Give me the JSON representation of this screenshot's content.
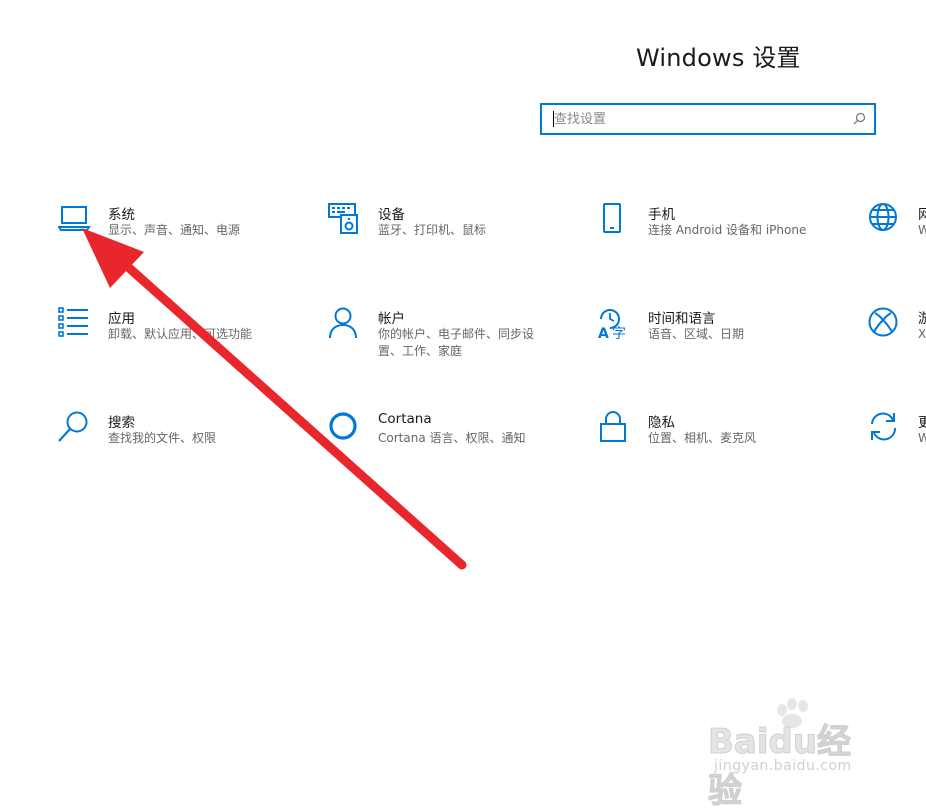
{
  "window": {
    "title": "Windows 设置"
  },
  "search": {
    "placeholder": "查找设置",
    "value": ""
  },
  "tiles": [
    {
      "name": "系统",
      "desc": "显示、声音、通知、电源",
      "icon": "laptop-icon"
    },
    {
      "name": "设备",
      "desc": "蓝牙、打印机、鼠标",
      "icon": "keyboard-devices-icon"
    },
    {
      "name": "手机",
      "desc": "连接 Android 设备和 iPhone",
      "icon": "phone-icon"
    },
    {
      "name": "网",
      "desc": "W",
      "icon": "globe-icon"
    },
    {
      "name": "应用",
      "desc": "卸载、默认应用、可选功能",
      "icon": "apps-list-icon"
    },
    {
      "name": "帐户",
      "desc": "你的帐户、电子邮件、同步设置、工作、家庭",
      "icon": "person-icon"
    },
    {
      "name": "时间和语言",
      "desc": "语音、区域、日期",
      "icon": "time-language-icon"
    },
    {
      "name": "游",
      "desc": "X",
      "icon": "xbox-icon"
    },
    {
      "name": "搜索",
      "desc": "查找我的文件、权限",
      "icon": "search-icon"
    },
    {
      "name": "Cortana",
      "desc": "Cortana 语言、权限、通知",
      "icon": "cortana-icon"
    },
    {
      "name": "隐私",
      "desc": "位置、相机、麦克风",
      "icon": "lock-icon"
    },
    {
      "name": "更",
      "desc": "W",
      "icon": "update-icon"
    }
  ],
  "colors": {
    "accent": "#0078d7",
    "annotation_arrow": "#e8262c"
  },
  "watermark": {
    "logo": "Baidu经验",
    "url": "jingyan.baidu.com"
  }
}
